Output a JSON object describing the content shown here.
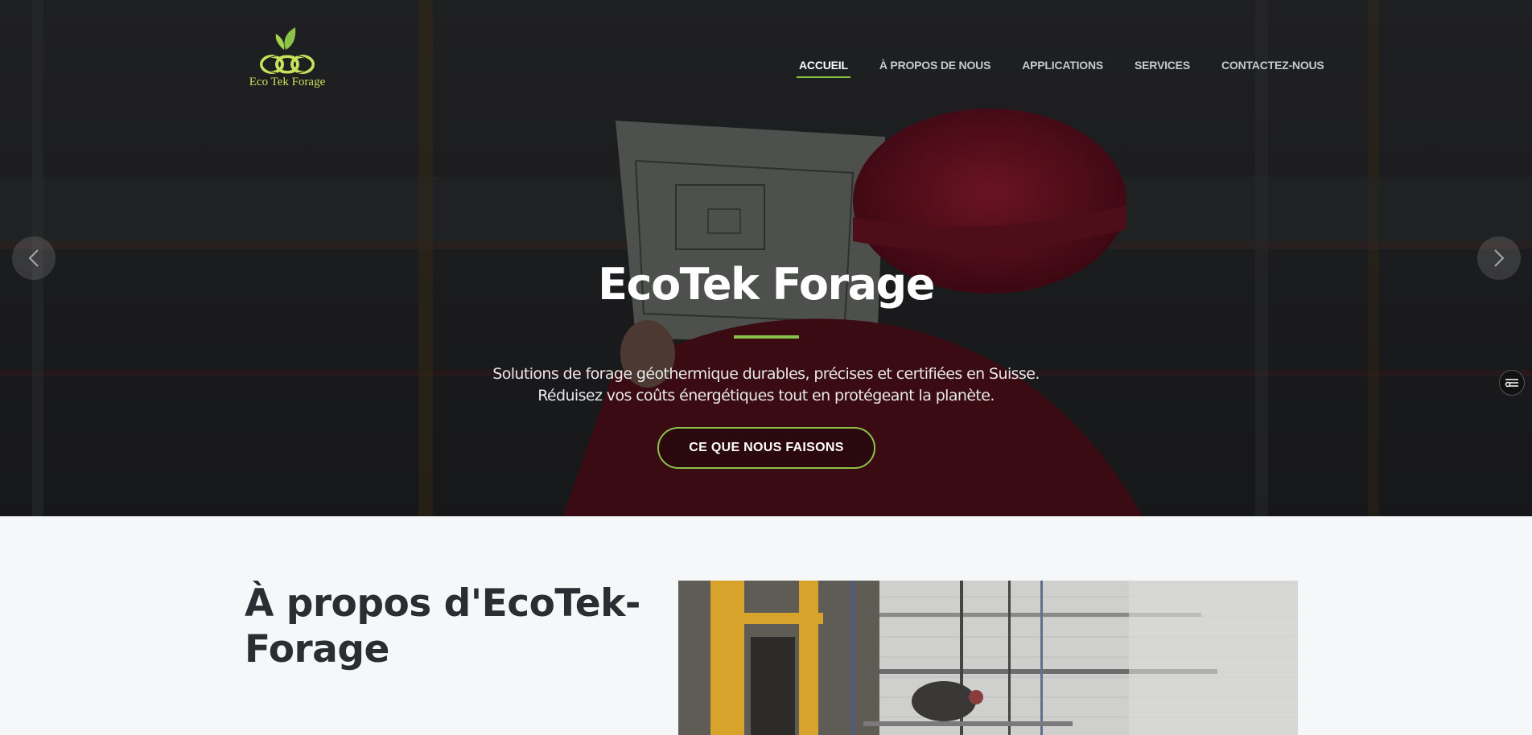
{
  "brand": {
    "logo_text": "Eco Tek Forage"
  },
  "nav": {
    "items": [
      {
        "label": "ACCUEIL",
        "active": true
      },
      {
        "label": "À PROPOS DE NOUS",
        "active": false
      },
      {
        "label": "APPLICATIONS",
        "active": false
      },
      {
        "label": "SERVICES",
        "active": false
      },
      {
        "label": "CONTACTEZ-NOUS",
        "active": false
      }
    ]
  },
  "hero": {
    "title": "EcoTek Forage",
    "subtitle_line1": "Solutions de forage géothermique durables, précises et certifiées en Suisse.",
    "subtitle_line2": "Réduisez vos coûts énergétiques tout en protégeant la planète.",
    "cta_label": "CE QUE NOUS FAISONS",
    "prev_icon": "chevron-left-icon",
    "next_icon": "chevron-right-icon"
  },
  "about": {
    "title_line1": "À propos d'EcoTek-",
    "title_line2": "Forage"
  },
  "colors": {
    "accent": "#8bc34a",
    "logo": "#c9e05a",
    "heading": "#2b2d33",
    "page_bg": "#f6f7f9"
  }
}
